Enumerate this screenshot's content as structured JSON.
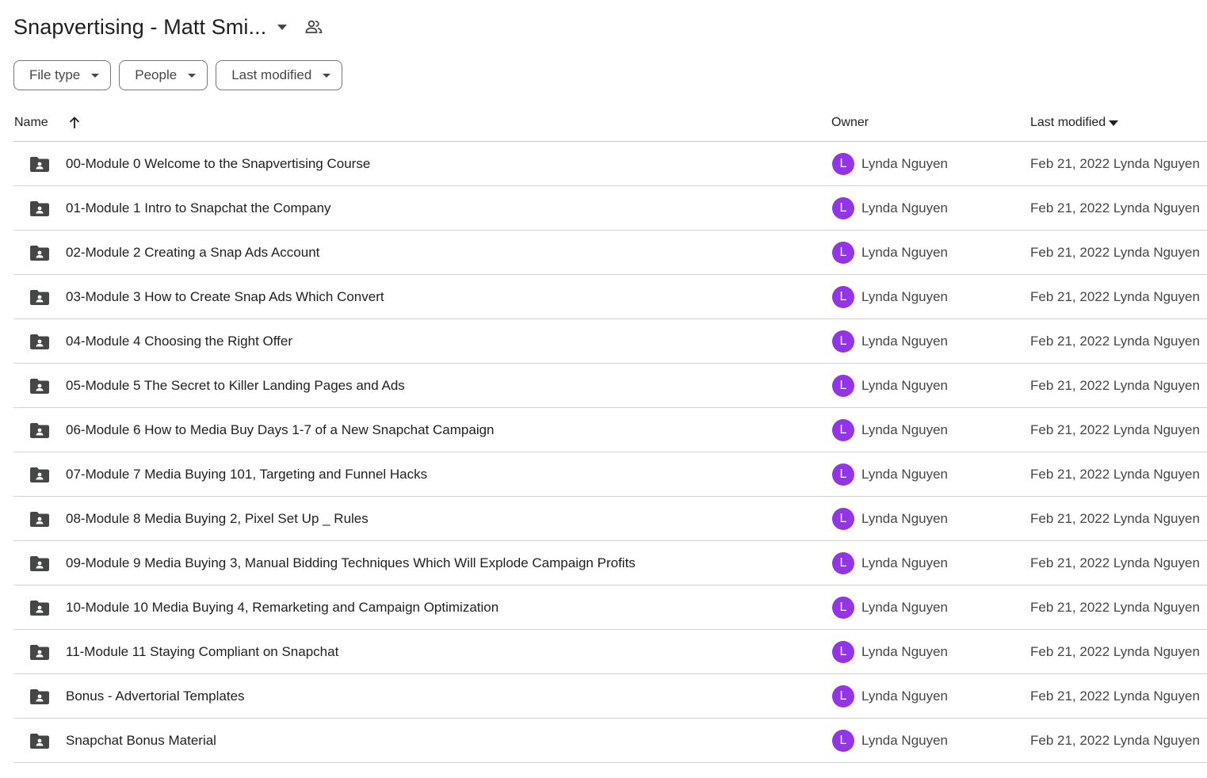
{
  "header": {
    "title": "Snapvertising - Matt Smi...",
    "title_menu_icon": "caret-down-icon",
    "shared_icon": "shared-people-icon"
  },
  "filters": [
    {
      "label": "File type",
      "icon": "caret-down-icon"
    },
    {
      "label": "People",
      "icon": "caret-down-icon"
    },
    {
      "label": "Last modified",
      "icon": "caret-down-icon"
    }
  ],
  "table": {
    "columns": {
      "name": "Name",
      "owner": "Owner",
      "last_modified": "Last modified"
    },
    "sort_icon": "arrow-up-icon",
    "rows": [
      {
        "name": "00-Module 0 Welcome to the Snapvertising Course",
        "owner_initial": "L",
        "owner": "Lynda Nguyen",
        "modified": "Feb 21, 2022 Lynda Nguyen"
      },
      {
        "name": "01-Module 1 Intro to Snapchat the Company",
        "owner_initial": "L",
        "owner": "Lynda Nguyen",
        "modified": "Feb 21, 2022 Lynda Nguyen"
      },
      {
        "name": "02-Module 2 Creating a Snap Ads Account",
        "owner_initial": "L",
        "owner": "Lynda Nguyen",
        "modified": "Feb 21, 2022 Lynda Nguyen"
      },
      {
        "name": "03-Module 3 How to Create Snap Ads Which Convert",
        "owner_initial": "L",
        "owner": "Lynda Nguyen",
        "modified": "Feb 21, 2022 Lynda Nguyen"
      },
      {
        "name": "04-Module 4 Choosing the Right Offer",
        "owner_initial": "L",
        "owner": "Lynda Nguyen",
        "modified": "Feb 21, 2022 Lynda Nguyen"
      },
      {
        "name": "05-Module 5 The Secret to Killer Landing Pages and Ads",
        "owner_initial": "L",
        "owner": "Lynda Nguyen",
        "modified": "Feb 21, 2022 Lynda Nguyen"
      },
      {
        "name": "06-Module 6 How to Media Buy Days 1-7 of a New Snapchat Campaign",
        "owner_initial": "L",
        "owner": "Lynda Nguyen",
        "modified": "Feb 21, 2022 Lynda Nguyen"
      },
      {
        "name": "07-Module 7 Media Buying 101, Targeting and Funnel Hacks",
        "owner_initial": "L",
        "owner": "Lynda Nguyen",
        "modified": "Feb 21, 2022 Lynda Nguyen"
      },
      {
        "name": "08-Module 8 Media Buying 2, Pixel Set Up _ Rules",
        "owner_initial": "L",
        "owner": "Lynda Nguyen",
        "modified": "Feb 21, 2022 Lynda Nguyen"
      },
      {
        "name": "09-Module 9 Media Buying 3, Manual Bidding Techniques Which Will Explode Campaign Profits",
        "owner_initial": "L",
        "owner": "Lynda Nguyen",
        "modified": "Feb 21, 2022 Lynda Nguyen"
      },
      {
        "name": "10-Module 10 Media Buying 4, Remarketing and Campaign Optimization",
        "owner_initial": "L",
        "owner": "Lynda Nguyen",
        "modified": "Feb 21, 2022 Lynda Nguyen"
      },
      {
        "name": "11-Module 11 Staying Compliant on Snapchat",
        "owner_initial": "L",
        "owner": "Lynda Nguyen",
        "modified": "Feb 21, 2022 Lynda Nguyen"
      },
      {
        "name": "Bonus - Advertorial Templates",
        "owner_initial": "L",
        "owner": "Lynda Nguyen",
        "modified": "Feb 21, 2022 Lynda Nguyen"
      },
      {
        "name": "Snapchat Bonus Material",
        "owner_initial": "L",
        "owner": "Lynda Nguyen",
        "modified": "Feb 21, 2022 Lynda Nguyen"
      }
    ],
    "row_icon": "shared-folder-icon"
  },
  "colors": {
    "avatar": "#9334e6",
    "text": "#1f1f1f",
    "secondary_text": "#444746",
    "divider": "#d3d3d3"
  }
}
